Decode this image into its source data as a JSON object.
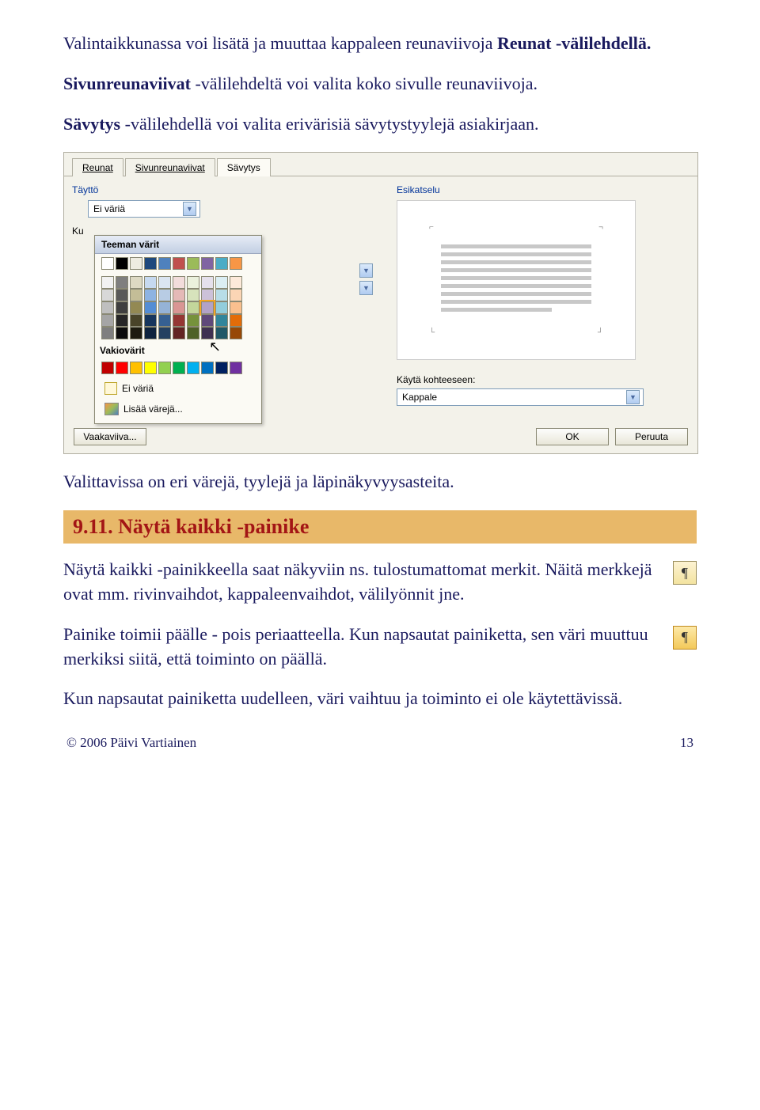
{
  "intro": {
    "p1_a": "Valintaikkunassa voi lisätä ja muuttaa kappaleen reunaviivoja ",
    "p1_b": "Reunat -välilehdellä.",
    "p2_a": "Sivunreunaviivat",
    "p2_b": " -välilehdeltä voi valita koko sivulle reunaviivoja.",
    "p3_a": "Sävytys",
    "p3_b": " -välilehdellä voi valita erivärisiä sävytystyylejä asiakirjaan."
  },
  "dialog": {
    "tabs": {
      "borders": "Reunat",
      "page_borders": "Sivunreunaviivat",
      "shading": "Sävytys"
    },
    "fill_label": "Täyttö",
    "no_color": "Ei väriä",
    "ku_label": "Ku",
    "popup": {
      "theme_title": "Teeman värit",
      "standard_title": "Vakiovärit",
      "no_color": "Ei väriä",
      "more_colors": "Lisää värejä..."
    },
    "preview_label": "Esikatselu",
    "apply_to_label": "Käytä kohteeseen:",
    "apply_to_value": "Kappale",
    "hline": "Vaakaviiva...",
    "ok": "OK",
    "cancel": "Peruuta"
  },
  "after_dialog": "Valittavissa on eri värejä, tyylejä ja läpinäkyvyysasteita.",
  "heading": "9.11.  Näytä kaikki -painike",
  "body": {
    "p1": "Näytä kaikki -painikkeella saat näkyviin ns. tulostumattomat merkit. Näitä merkkejä ovat mm. rivinvaihdot, kappaleenvaihdot, välilyönnit jne.",
    "p2": "Painike toimii päälle - pois periaatteella. Kun napsautat painiketta, sen väri muuttuu merkiksi siitä, että toiminto on päällä.",
    "p3": "Kun napsautat painiketta uudelleen, väri vaihtuu ja toiminto ei ole käytettävissä."
  },
  "footer": {
    "copyright": "© 2006 Päivi Vartiainen",
    "page": "13"
  },
  "colors": {
    "theme_row1": [
      "#ffffff",
      "#000000",
      "#eeece1",
      "#1f497d",
      "#4f81bd",
      "#c0504d",
      "#9bbb59",
      "#8064a2",
      "#4bacc6",
      "#f79646"
    ],
    "theme_tints": [
      [
        "#f2f2f2",
        "#7f7f7f",
        "#ddd9c3",
        "#c6d9f0",
        "#dbe5f1",
        "#f2dcdb",
        "#ebf1dd",
        "#e5e0ec",
        "#dbeef3",
        "#fdeada"
      ],
      [
        "#d8d8d8",
        "#595959",
        "#c4bd97",
        "#8db3e2",
        "#b8cce4",
        "#e5b9b7",
        "#d7e3bc",
        "#ccc1d9",
        "#b7dde8",
        "#fbd5b5"
      ],
      [
        "#bfbfbf",
        "#3f3f3f",
        "#938953",
        "#548dd4",
        "#95b3d7",
        "#d99694",
        "#c3d69b",
        "#b2a2c7",
        "#92cddc",
        "#fac08f"
      ],
      [
        "#a5a5a5",
        "#262626",
        "#494429",
        "#17365d",
        "#366092",
        "#953734",
        "#76923c",
        "#5f497a",
        "#31859b",
        "#e36c09"
      ],
      [
        "#7f7f7f",
        "#0c0c0c",
        "#1d1b10",
        "#0f243e",
        "#244061",
        "#632423",
        "#4f6128",
        "#3f3151",
        "#205867",
        "#974806"
      ]
    ],
    "standard": [
      "#c00000",
      "#ff0000",
      "#ffc000",
      "#ffff00",
      "#92d050",
      "#00b050",
      "#00b0f0",
      "#0070c0",
      "#002060",
      "#7030a0"
    ]
  }
}
